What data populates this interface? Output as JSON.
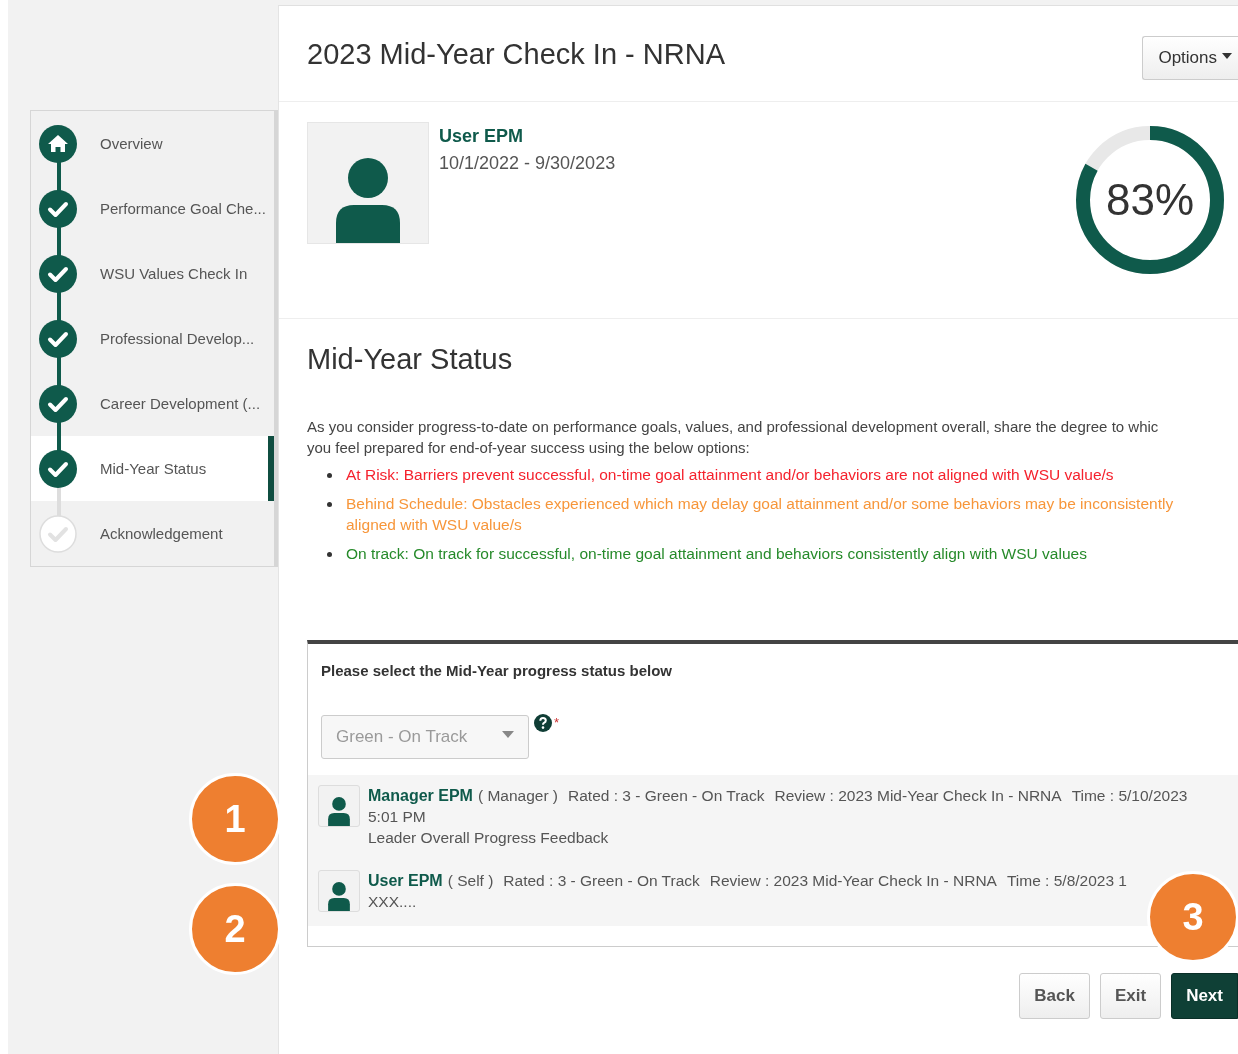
{
  "sidebar": {
    "items": [
      {
        "kind": "home",
        "label": "Overview",
        "completed": true,
        "selected": false
      },
      {
        "kind": "step",
        "label": "Performance Goal Che...",
        "completed": true,
        "selected": false
      },
      {
        "kind": "step",
        "label": "WSU Values Check In",
        "completed": true,
        "selected": false
      },
      {
        "kind": "step",
        "label": "Professional Develop...",
        "completed": true,
        "selected": false
      },
      {
        "kind": "step",
        "label": "Career Development (...",
        "completed": true,
        "selected": false
      },
      {
        "kind": "step",
        "label": "Mid-Year Status",
        "completed": true,
        "selected": true
      },
      {
        "kind": "step",
        "label": "Acknowledgement",
        "completed": false,
        "selected": false
      }
    ]
  },
  "header": {
    "title": "2023 Mid-Year Check In - NRNA",
    "options_button": "Options"
  },
  "profile": {
    "name": "User EPM",
    "period": "10/1/2022 - 9/30/2023",
    "progress": {
      "level": 0.83,
      "reading": "83%"
    }
  },
  "section": {
    "title": "Mid-Year Status",
    "intro": "As you consider progress-to-date on performance goals, values, and professional development overall, share the degree to whic\nyou feel prepared for end-of-year success using the below options:",
    "options": [
      {
        "text": "At Risk: Barriers prevent successful, on-time goal attainment and/or behaviors are not aligned with WSU value/s",
        "color": "#f5222d"
      },
      {
        "text": "Behind Schedule: Obstacles experienced which may delay goal attainment and/or some behaviors may be inconsistently aligned with WSU value/s",
        "color": "#f7963a"
      },
      {
        "text": "On track: On track for successful, on-time goal attainment and behaviors consistently align with WSU values",
        "color": "#268a2a"
      }
    ]
  },
  "form": {
    "prompt": "Please select the Mid-Year progress status below",
    "dropdown": {
      "value": "Green - On Track",
      "disabled": true
    },
    "required_mark": "*",
    "comments": [
      {
        "name": "Manager EPM",
        "role": "( Manager )",
        "rated": "Rated : 3 - Green - On Track",
        "review": "Review : 2023 Mid-Year Check In - NRNA",
        "time": "Time : 5/10/2023 5:01 PM",
        "body": "Leader Overall Progress Feedback"
      },
      {
        "name": "User EPM",
        "role": "( Self )",
        "rated": "Rated : 3 - Green - On Track",
        "review": "Review : 2023 Mid-Year Check In - NRNA",
        "time": "Time : 5/8/2023 1",
        "body": "XXX...."
      }
    ]
  },
  "buttons": [
    {
      "label": "Back",
      "primary": false
    },
    {
      "label": "Exit",
      "primary": false
    },
    {
      "label": "Next",
      "primary": true
    }
  ],
  "callouts": [
    {
      "label": "1"
    },
    {
      "label": "2"
    },
    {
      "label": "3"
    }
  ]
}
